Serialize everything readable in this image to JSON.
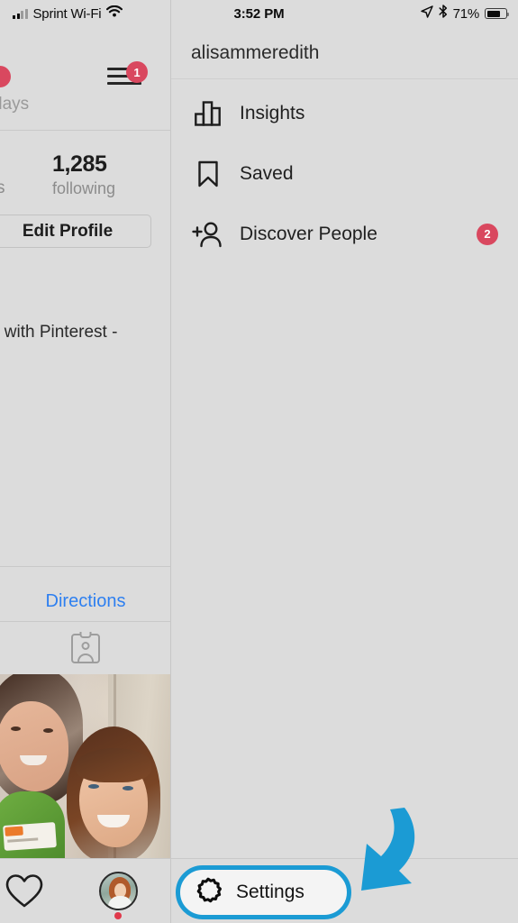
{
  "status_bar": {
    "carrier": "Sprint Wi-Fi",
    "wifi_icon": "wifi-icon",
    "signal_icon": "cellular-signal-icon",
    "time": "3:52 PM",
    "location_icon": "location-arrow-icon",
    "bluetooth_icon": "bluetooth-icon",
    "battery_percent": "71%",
    "battery_icon": "battery-icon"
  },
  "left_panel": {
    "hamburger_icon": "hamburger-menu-icon",
    "hamburger_badge": "1",
    "days_label": "days",
    "stat_cut_label": "s",
    "following_count": "1,285",
    "following_label": "following",
    "edit_profile_label": "Edit Profile",
    "bio_text": "s with Pinterest -",
    "directions_label": "Directions",
    "tagged_icon": "tagged-photos-icon",
    "heart_icon": "heart-activity-icon",
    "avatar_icon": "profile-avatar-icon"
  },
  "menu_panel": {
    "username": "alisammeredith",
    "items": [
      {
        "label": "Insights",
        "icon": "insights-bar-chart-icon",
        "badge": ""
      },
      {
        "label": "Saved",
        "icon": "bookmark-saved-icon",
        "badge": ""
      },
      {
        "label": "Discover People",
        "icon": "add-person-icon",
        "badge": "2"
      }
    ],
    "settings": {
      "label": "Settings",
      "icon": "gear-settings-icon"
    }
  },
  "annotation": {
    "arrow_icon": "curved-arrow-pointing-to-settings",
    "arrow_color": "#1b9bd4",
    "highlight_color": "#1b9bd4"
  },
  "colors": {
    "background": "#dcdcdc",
    "badge_red": "#d9485f",
    "link_blue": "#2d7ff0",
    "accent_blue": "#1b9bd4",
    "text_dark": "#1f1f1f",
    "text_muted": "#8c8c8c"
  }
}
